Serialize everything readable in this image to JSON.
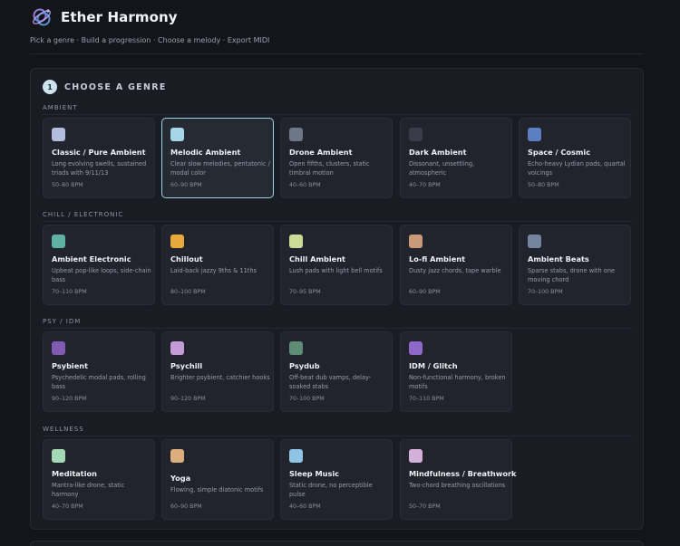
{
  "app": {
    "title": "Ether Harmony",
    "subtitle": "Pick a genre · Build a progression · Choose a melody · Export MIDI",
    "logo_icon": "harmony-orbit-logo-icon"
  },
  "step": {
    "number": "1",
    "title": "CHOOSE A GENRE"
  },
  "categories": [
    {
      "label": "AMBIENT",
      "genres": [
        {
          "name": "Classic / Pure Ambient",
          "desc": "Long evolving swells, sustained triads with 9/11/13",
          "bpm": "50–80 BPM",
          "color": "#b3bedf",
          "selected": false
        },
        {
          "name": "Melodic Ambient",
          "desc": "Clear slow melodies, pentatonic / modal color",
          "bpm": "60–90 BPM",
          "color": "#a7d6e8",
          "selected": true
        },
        {
          "name": "Drone Ambient",
          "desc": "Open fifths, clusters, static timbral motion",
          "bpm": "40–60 BPM",
          "color": "#6e7788",
          "selected": false
        },
        {
          "name": "Dark Ambient",
          "desc": "Dissonant, unsettling, atmospheric",
          "bpm": "40–70 BPM",
          "color": "#3b3c49",
          "selected": false
        },
        {
          "name": "Space / Cosmic",
          "desc": "Echo-heavy Lydian pads, quartal voicings",
          "bpm": "50–80 BPM",
          "color": "#5c7fc2",
          "selected": false
        }
      ]
    },
    {
      "label": "CHILL / ELECTRONIC",
      "genres": [
        {
          "name": "Ambient Electronic",
          "desc": "Upbeat pop-like loops, side-chain bass",
          "bpm": "70–110 BPM",
          "color": "#5fb1a3",
          "selected": false
        },
        {
          "name": "Chillout",
          "desc": "Laid-back jazzy 9ths & 11ths",
          "bpm": "80–100 BPM",
          "color": "#e7a93c",
          "selected": false
        },
        {
          "name": "Chill Ambient",
          "desc": "Lush pads with light bell motifs",
          "bpm": "70–95 BPM",
          "color": "#cedb97",
          "selected": false
        },
        {
          "name": "Lo-fi Ambient",
          "desc": "Dusty jazz chords, tape warble",
          "bpm": "60–90 BPM",
          "color": "#c99a78",
          "selected": false
        },
        {
          "name": "Ambient Beats",
          "desc": "Sparse stabs, drone with one moving chord",
          "bpm": "70–100 BPM",
          "color": "#76849d",
          "selected": false
        }
      ]
    },
    {
      "label": "PSY / IDM",
      "genres": [
        {
          "name": "Psybient",
          "desc": "Psychedelic modal pads, rolling bass",
          "bpm": "90–120 BPM",
          "color": "#7f5bb2",
          "selected": false
        },
        {
          "name": "Psychill",
          "desc": "Brighter psybient, catchier hooks",
          "bpm": "90–120 BPM",
          "color": "#c49bd6",
          "selected": false
        },
        {
          "name": "Psydub",
          "desc": "Off-beat dub vamps, delay-soaked stabs",
          "bpm": "70–100 BPM",
          "color": "#5e8c75",
          "selected": false
        },
        {
          "name": "IDM / Glitch",
          "desc": "Non-functional harmony, broken motifs",
          "bpm": "70–110 BPM",
          "color": "#8e68c8",
          "selected": false
        }
      ]
    },
    {
      "label": "WELLNESS",
      "genres": [
        {
          "name": "Meditation",
          "desc": "Mantra-like drone, static harmony",
          "bpm": "40–70 BPM",
          "color": "#a3d9b6",
          "selected": false
        },
        {
          "name": "Yoga",
          "desc": "Flowing, simple diatonic motifs",
          "bpm": "60–90 BPM",
          "color": "#dcae7d",
          "selected": false
        },
        {
          "name": "Sleep Music",
          "desc": "Static drone, no perceptible pulse",
          "bpm": "40–60 BPM",
          "color": "#8fc4e6",
          "selected": false
        },
        {
          "name": "Mindfulness / Breathwork",
          "desc": "Two-chord breathing oscillations",
          "bpm": "50–70 BPM",
          "color": "#d2b0da",
          "selected": false
        }
      ]
    }
  ]
}
